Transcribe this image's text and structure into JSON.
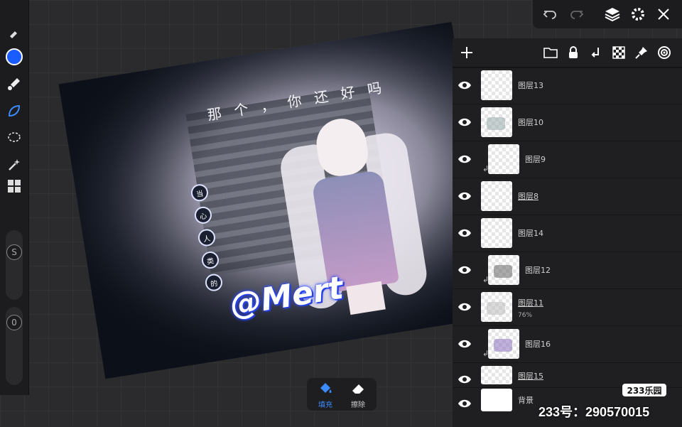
{
  "toolbar": {
    "left": [
      {
        "name": "brush-icon"
      },
      {
        "name": "color-swatch",
        "color": "#1a5cff"
      },
      {
        "name": "paint-brush-icon"
      },
      {
        "name": "smudge-icon"
      },
      {
        "name": "lasso-icon"
      },
      {
        "name": "magic-wand-icon"
      },
      {
        "name": "grid-icon"
      }
    ],
    "size_knob": "S",
    "opacity_knob": "0"
  },
  "artwork": {
    "title_text": "那个，你还好吗",
    "watermark": "@Mert",
    "circle_labels": [
      "当",
      "心",
      "人",
      "类",
      "的"
    ]
  },
  "layers": {
    "items": [
      {
        "name": "图层13",
        "underlined": false,
        "clipped": false,
        "sub": ""
      },
      {
        "name": "图层10",
        "underlined": false,
        "clipped": false,
        "sub": ""
      },
      {
        "name": "图层9",
        "underlined": false,
        "clipped": true,
        "sub": ""
      },
      {
        "name": "图层8",
        "underlined": true,
        "clipped": false,
        "sub": ""
      },
      {
        "name": "图层14",
        "underlined": false,
        "clipped": false,
        "sub": ""
      },
      {
        "name": "图层12",
        "underlined": false,
        "clipped": true,
        "sub": ""
      },
      {
        "name": "图层11",
        "underlined": true,
        "clipped": false,
        "sub": "76%"
      },
      {
        "name": "图层16",
        "underlined": false,
        "clipped": true,
        "sub": ""
      },
      {
        "name": "图层15",
        "underlined": true,
        "clipped": false,
        "sub": ""
      },
      {
        "name": "背景",
        "underlined": false,
        "clipped": false,
        "sub": ""
      }
    ]
  },
  "mini": {
    "fill": "填充",
    "erase": "擦除"
  },
  "badge": {
    "logo": "233乐园",
    "id": "233号：290570015"
  },
  "colors": {
    "accent": "#3b8bff",
    "swatch": "#1a5cff"
  }
}
